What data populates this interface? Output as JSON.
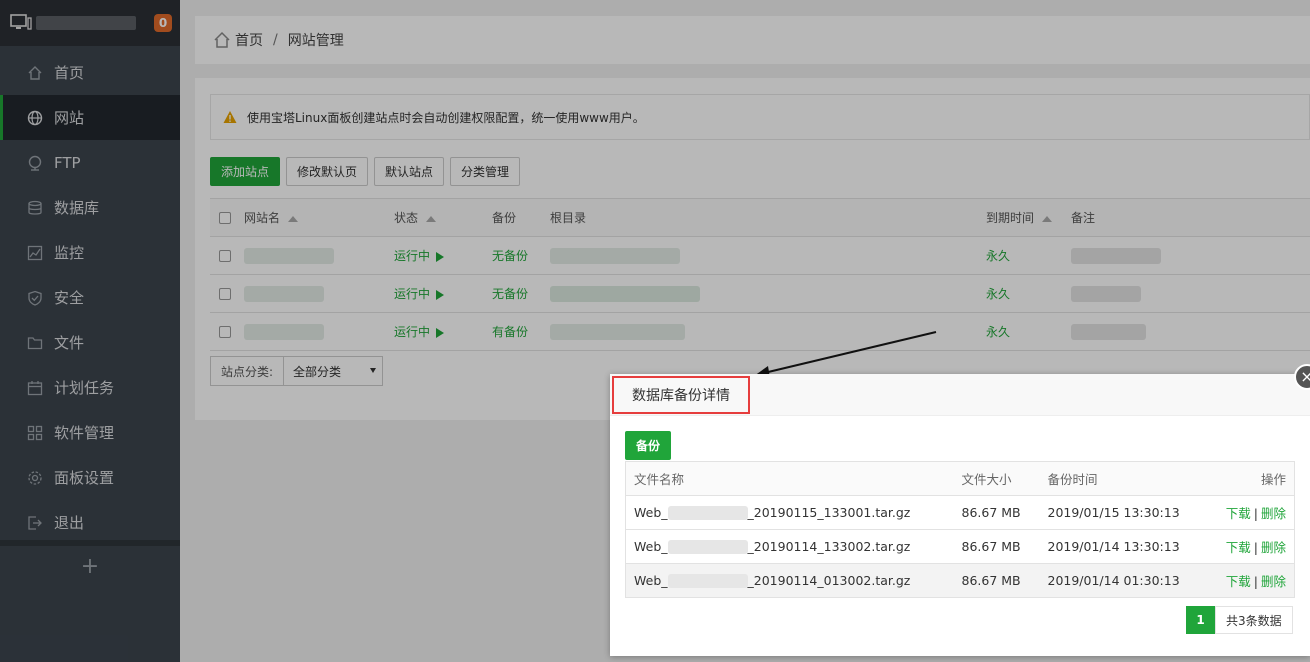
{
  "sidebar": {
    "badge": "0",
    "items": [
      {
        "label": "首页",
        "icon": "home-icon"
      },
      {
        "label": "网站",
        "icon": "globe-icon",
        "active": true
      },
      {
        "label": "FTP",
        "icon": "ftp-icon"
      },
      {
        "label": "数据库",
        "icon": "database-icon"
      },
      {
        "label": "监控",
        "icon": "monitor-icon"
      },
      {
        "label": "安全",
        "icon": "shield-icon"
      },
      {
        "label": "文件",
        "icon": "folder-icon"
      },
      {
        "label": "计划任务",
        "icon": "calendar-icon"
      },
      {
        "label": "软件管理",
        "icon": "grid-icon"
      },
      {
        "label": "面板设置",
        "icon": "gear-icon"
      },
      {
        "label": "退出",
        "icon": "logout-icon"
      }
    ],
    "add_label": "+"
  },
  "breadcrumb": {
    "home": "首页",
    "separator": "/",
    "current": "网站管理"
  },
  "notice": "使用宝塔Linux面板创建站点时会自动创建权限配置，统一使用www用户。",
  "toolbar": {
    "add_site": "添加站点",
    "edit_default_page": "修改默认页",
    "default_site": "默认站点",
    "category_manage": "分类管理"
  },
  "sites_table": {
    "headers": {
      "name": "网站名",
      "status": "状态",
      "backup": "备份",
      "root": "根目录",
      "expire": "到期时间",
      "note": "备注"
    },
    "rows": [
      {
        "status": "运行中",
        "backup": "无备份",
        "expire": "永久"
      },
      {
        "status": "运行中",
        "backup": "无备份",
        "expire": "永久"
      },
      {
        "status": "运行中",
        "backup": "有备份",
        "expire": "永久"
      }
    ]
  },
  "category": {
    "label": "站点分类:",
    "selected": "全部分类"
  },
  "modal": {
    "title": "数据库备份详情",
    "close": "×",
    "backup_button": "备份",
    "headers": {
      "filename": "文件名称",
      "size": "文件大小",
      "time": "备份时间",
      "ops": "操作"
    },
    "rows": [
      {
        "prefix": "Web_",
        "suffix": "_20190115_133001.tar.gz",
        "size": "86.67 MB",
        "time": "2019/01/15 13:30:13",
        "download": "下载",
        "delete": "删除"
      },
      {
        "prefix": "Web_",
        "suffix": "_20190114_133002.tar.gz",
        "size": "86.67 MB",
        "time": "2019/01/14 13:30:13",
        "download": "下载",
        "delete": "删除"
      },
      {
        "prefix": "Web_",
        "suffix": "_20190114_013002.tar.gz",
        "size": "86.67 MB",
        "time": "2019/01/14 01:30:13",
        "download": "下载",
        "delete": "删除"
      }
    ],
    "pager": {
      "current": "1",
      "total": "共3条数据"
    },
    "op_separator": "|"
  },
  "colors": {
    "accent": "#20a53a",
    "sidebar": "#3c444d",
    "highlight_border": "#e63d3d",
    "badge": "#e06a2a"
  }
}
